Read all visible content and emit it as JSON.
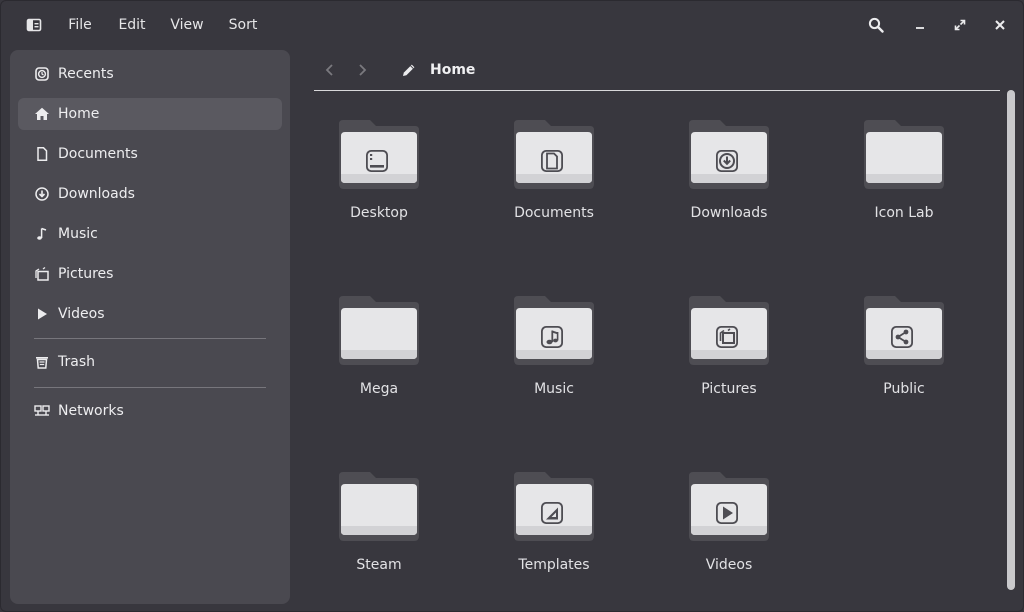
{
  "menubar": {
    "app_icon": "sidebar-toggle-icon",
    "items": [
      {
        "label": "File"
      },
      {
        "label": "Edit"
      },
      {
        "label": "View"
      },
      {
        "label": "Sort"
      }
    ]
  },
  "window_controls": {
    "search_icon": "search-icon",
    "minimize_icon": "minimize-icon",
    "maximize_icon": "maximize-icon",
    "close_icon": "close-icon"
  },
  "sidebar": {
    "items": [
      {
        "label": "Recents",
        "icon": "recents-icon"
      },
      {
        "label": "Home",
        "icon": "home-icon",
        "active": true
      },
      {
        "label": "Documents",
        "icon": "document-icon"
      },
      {
        "label": "Downloads",
        "icon": "download-icon"
      },
      {
        "label": "Music",
        "icon": "music-icon"
      },
      {
        "label": "Pictures",
        "icon": "pictures-icon"
      },
      {
        "label": "Videos",
        "icon": "play-icon"
      },
      {
        "label": "Trash",
        "icon": "trash-icon"
      },
      {
        "label": "Networks",
        "icon": "network-icon"
      }
    ]
  },
  "toolbar": {
    "back_icon": "chevron-left-icon",
    "forward_icon": "chevron-right-icon",
    "edit_icon": "pencil-icon",
    "path": "Home"
  },
  "files": [
    {
      "name": "Desktop",
      "emblem": "desktop"
    },
    {
      "name": "Documents",
      "emblem": "document"
    },
    {
      "name": "Downloads",
      "emblem": "download"
    },
    {
      "name": "Icon Lab",
      "emblem": "none"
    },
    {
      "name": "Mega",
      "emblem": "none"
    },
    {
      "name": "Music",
      "emblem": "music"
    },
    {
      "name": "Pictures",
      "emblem": "pictures"
    },
    {
      "name": "Public",
      "emblem": "share"
    },
    {
      "name": "Steam",
      "emblem": "none"
    },
    {
      "name": "Templates",
      "emblem": "template"
    },
    {
      "name": "Videos",
      "emblem": "video"
    }
  ],
  "colors": {
    "window_bg": "#38373e",
    "sidebar_bg": "#4a4950",
    "active_item_bg": "#5a5960",
    "folder_light": "#e6e6e8",
    "folder_dark": "#4e4d53"
  }
}
